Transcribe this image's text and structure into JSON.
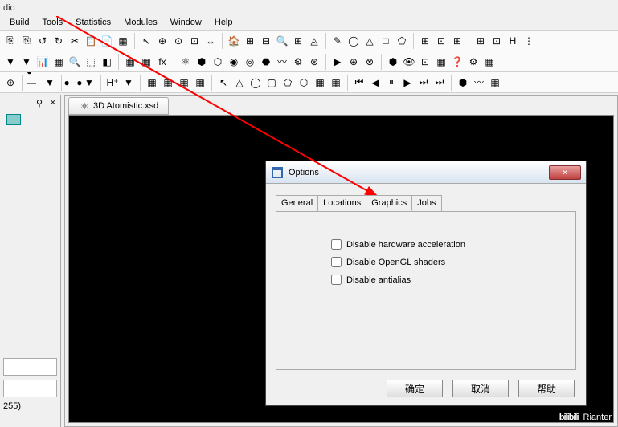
{
  "app": {
    "title_fragment": "dio"
  },
  "menu": {
    "items": [
      "Build",
      "Tools",
      "Statistics",
      "Modules",
      "Window",
      "Help"
    ]
  },
  "toolbar": {
    "row1": [
      "⎘",
      "⎘",
      "↺",
      "↻",
      "✂",
      "📋",
      "📄",
      "▦",
      "",
      "↖",
      "⊕",
      "⊙",
      "⊡",
      "↔",
      "",
      "🏠",
      "⊞",
      "⊟",
      "🔍",
      "⊞",
      "◬",
      "",
      "✎",
      "◯",
      "△",
      "□",
      "⬠",
      "",
      "⊞",
      "⊡",
      "⊞",
      "",
      "⊞",
      "⊡",
      "H",
      "⋮"
    ],
    "row2": [
      "▼",
      "▼",
      "📊",
      "▦",
      "🔍",
      "⬚",
      "◧",
      "",
      "▦",
      "▦",
      "fx",
      "",
      "⚛",
      "⬢",
      "⬡",
      "◉",
      "◎",
      "⬣",
      "〰",
      "⚙",
      "⊛",
      "",
      "▶",
      "⊕",
      "⊗",
      "",
      "⬢",
      "👁",
      "⊡",
      "▦",
      "❓",
      "⚙",
      "▦"
    ],
    "row3": [
      "⊕",
      "",
      "●—●",
      "▼",
      "",
      "●─●",
      "▼",
      "",
      "H⁺",
      "▼",
      "",
      "▦",
      "▦",
      "▦",
      "▦",
      "",
      "↖",
      "△",
      "◯",
      "▢",
      "⬠",
      "⬡",
      "▦",
      "▦",
      "",
      "⏮",
      "◀",
      "⏸",
      "▶",
      "⏭",
      "⏭",
      "",
      "⬢",
      "〰",
      "▦"
    ]
  },
  "left_panel": {
    "close": "×",
    "pin": "⚲",
    "value255": "255)"
  },
  "document": {
    "tab_label": "3D Atomistic.xsd",
    "tab_icon": "⚛"
  },
  "dialog": {
    "title": "Options",
    "close": "×",
    "tabs": [
      "General",
      "Locations",
      "Graphics",
      "Jobs"
    ],
    "checkboxes": {
      "disable_hw": "Disable hardware acceleration",
      "disable_shaders": "Disable OpenGL shaders",
      "disable_aa": "Disable antialias"
    },
    "buttons": {
      "ok": "确定",
      "cancel": "取消",
      "help": "帮助"
    }
  },
  "watermark": {
    "bili": "bilibili",
    "name": "Rianter"
  }
}
